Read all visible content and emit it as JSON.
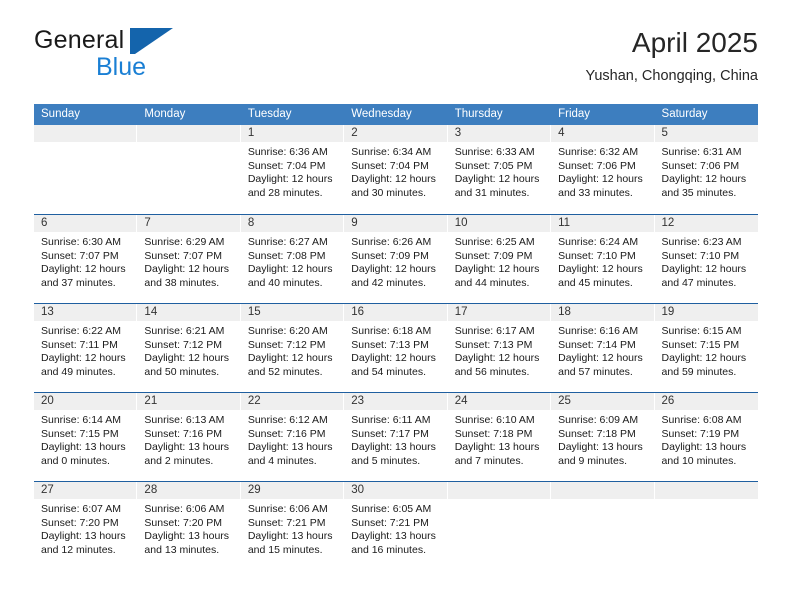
{
  "brand": {
    "name_part1": "General",
    "name_part2": "Blue",
    "logo_icon": "triangle-flag-icon"
  },
  "header": {
    "title": "April 2025",
    "subtitle": "Yushan, Chongqing, China"
  },
  "weekdays": [
    "Sunday",
    "Monday",
    "Tuesday",
    "Wednesday",
    "Thursday",
    "Friday",
    "Saturday"
  ],
  "colors": {
    "header_blue": "#3d7ebf",
    "week_divider_blue": "#1f5fa0",
    "day_band_gray": "#efefef",
    "brand_blue": "#1a7fd4"
  },
  "weeks": [
    [
      {
        "num": "",
        "sunrise": "",
        "sunset": "",
        "daylight1": "",
        "daylight2": "",
        "empty": true
      },
      {
        "num": "",
        "sunrise": "",
        "sunset": "",
        "daylight1": "",
        "daylight2": "",
        "empty": true
      },
      {
        "num": "1",
        "sunrise": "Sunrise: 6:36 AM",
        "sunset": "Sunset: 7:04 PM",
        "daylight1": "Daylight: 12 hours",
        "daylight2": "and 28 minutes."
      },
      {
        "num": "2",
        "sunrise": "Sunrise: 6:34 AM",
        "sunset": "Sunset: 7:04 PM",
        "daylight1": "Daylight: 12 hours",
        "daylight2": "and 30 minutes."
      },
      {
        "num": "3",
        "sunrise": "Sunrise: 6:33 AM",
        "sunset": "Sunset: 7:05 PM",
        "daylight1": "Daylight: 12 hours",
        "daylight2": "and 31 minutes."
      },
      {
        "num": "4",
        "sunrise": "Sunrise: 6:32 AM",
        "sunset": "Sunset: 7:06 PM",
        "daylight1": "Daylight: 12 hours",
        "daylight2": "and 33 minutes."
      },
      {
        "num": "5",
        "sunrise": "Sunrise: 6:31 AM",
        "sunset": "Sunset: 7:06 PM",
        "daylight1": "Daylight: 12 hours",
        "daylight2": "and 35 minutes."
      }
    ],
    [
      {
        "num": "6",
        "sunrise": "Sunrise: 6:30 AM",
        "sunset": "Sunset: 7:07 PM",
        "daylight1": "Daylight: 12 hours",
        "daylight2": "and 37 minutes."
      },
      {
        "num": "7",
        "sunrise": "Sunrise: 6:29 AM",
        "sunset": "Sunset: 7:07 PM",
        "daylight1": "Daylight: 12 hours",
        "daylight2": "and 38 minutes."
      },
      {
        "num": "8",
        "sunrise": "Sunrise: 6:27 AM",
        "sunset": "Sunset: 7:08 PM",
        "daylight1": "Daylight: 12 hours",
        "daylight2": "and 40 minutes."
      },
      {
        "num": "9",
        "sunrise": "Sunrise: 6:26 AM",
        "sunset": "Sunset: 7:09 PM",
        "daylight1": "Daylight: 12 hours",
        "daylight2": "and 42 minutes."
      },
      {
        "num": "10",
        "sunrise": "Sunrise: 6:25 AM",
        "sunset": "Sunset: 7:09 PM",
        "daylight1": "Daylight: 12 hours",
        "daylight2": "and 44 minutes."
      },
      {
        "num": "11",
        "sunrise": "Sunrise: 6:24 AM",
        "sunset": "Sunset: 7:10 PM",
        "daylight1": "Daylight: 12 hours",
        "daylight2": "and 45 minutes."
      },
      {
        "num": "12",
        "sunrise": "Sunrise: 6:23 AM",
        "sunset": "Sunset: 7:10 PM",
        "daylight1": "Daylight: 12 hours",
        "daylight2": "and 47 minutes."
      }
    ],
    [
      {
        "num": "13",
        "sunrise": "Sunrise: 6:22 AM",
        "sunset": "Sunset: 7:11 PM",
        "daylight1": "Daylight: 12 hours",
        "daylight2": "and 49 minutes."
      },
      {
        "num": "14",
        "sunrise": "Sunrise: 6:21 AM",
        "sunset": "Sunset: 7:12 PM",
        "daylight1": "Daylight: 12 hours",
        "daylight2": "and 50 minutes."
      },
      {
        "num": "15",
        "sunrise": "Sunrise: 6:20 AM",
        "sunset": "Sunset: 7:12 PM",
        "daylight1": "Daylight: 12 hours",
        "daylight2": "and 52 minutes."
      },
      {
        "num": "16",
        "sunrise": "Sunrise: 6:18 AM",
        "sunset": "Sunset: 7:13 PM",
        "daylight1": "Daylight: 12 hours",
        "daylight2": "and 54 minutes."
      },
      {
        "num": "17",
        "sunrise": "Sunrise: 6:17 AM",
        "sunset": "Sunset: 7:13 PM",
        "daylight1": "Daylight: 12 hours",
        "daylight2": "and 56 minutes."
      },
      {
        "num": "18",
        "sunrise": "Sunrise: 6:16 AM",
        "sunset": "Sunset: 7:14 PM",
        "daylight1": "Daylight: 12 hours",
        "daylight2": "and 57 minutes."
      },
      {
        "num": "19",
        "sunrise": "Sunrise: 6:15 AM",
        "sunset": "Sunset: 7:15 PM",
        "daylight1": "Daylight: 12 hours",
        "daylight2": "and 59 minutes."
      }
    ],
    [
      {
        "num": "20",
        "sunrise": "Sunrise: 6:14 AM",
        "sunset": "Sunset: 7:15 PM",
        "daylight1": "Daylight: 13 hours",
        "daylight2": "and 0 minutes."
      },
      {
        "num": "21",
        "sunrise": "Sunrise: 6:13 AM",
        "sunset": "Sunset: 7:16 PM",
        "daylight1": "Daylight: 13 hours",
        "daylight2": "and 2 minutes."
      },
      {
        "num": "22",
        "sunrise": "Sunrise: 6:12 AM",
        "sunset": "Sunset: 7:16 PM",
        "daylight1": "Daylight: 13 hours",
        "daylight2": "and 4 minutes."
      },
      {
        "num": "23",
        "sunrise": "Sunrise: 6:11 AM",
        "sunset": "Sunset: 7:17 PM",
        "daylight1": "Daylight: 13 hours",
        "daylight2": "and 5 minutes."
      },
      {
        "num": "24",
        "sunrise": "Sunrise: 6:10 AM",
        "sunset": "Sunset: 7:18 PM",
        "daylight1": "Daylight: 13 hours",
        "daylight2": "and 7 minutes."
      },
      {
        "num": "25",
        "sunrise": "Sunrise: 6:09 AM",
        "sunset": "Sunset: 7:18 PM",
        "daylight1": "Daylight: 13 hours",
        "daylight2": "and 9 minutes."
      },
      {
        "num": "26",
        "sunrise": "Sunrise: 6:08 AM",
        "sunset": "Sunset: 7:19 PM",
        "daylight1": "Daylight: 13 hours",
        "daylight2": "and 10 minutes."
      }
    ],
    [
      {
        "num": "27",
        "sunrise": "Sunrise: 6:07 AM",
        "sunset": "Sunset: 7:20 PM",
        "daylight1": "Daylight: 13 hours",
        "daylight2": "and 12 minutes."
      },
      {
        "num": "28",
        "sunrise": "Sunrise: 6:06 AM",
        "sunset": "Sunset: 7:20 PM",
        "daylight1": "Daylight: 13 hours",
        "daylight2": "and 13 minutes."
      },
      {
        "num": "29",
        "sunrise": "Sunrise: 6:06 AM",
        "sunset": "Sunset: 7:21 PM",
        "daylight1": "Daylight: 13 hours",
        "daylight2": "and 15 minutes."
      },
      {
        "num": "30",
        "sunrise": "Sunrise: 6:05 AM",
        "sunset": "Sunset: 7:21 PM",
        "daylight1": "Daylight: 13 hours",
        "daylight2": "and 16 minutes."
      },
      {
        "num": "",
        "sunrise": "",
        "sunset": "",
        "daylight1": "",
        "daylight2": "",
        "empty": true
      },
      {
        "num": "",
        "sunrise": "",
        "sunset": "",
        "daylight1": "",
        "daylight2": "",
        "empty": true
      },
      {
        "num": "",
        "sunrise": "",
        "sunset": "",
        "daylight1": "",
        "daylight2": "",
        "empty": true
      }
    ]
  ]
}
